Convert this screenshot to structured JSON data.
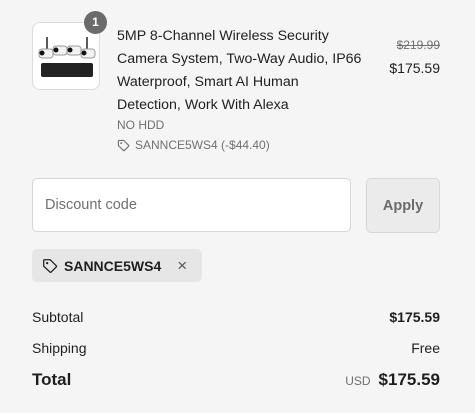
{
  "line_item": {
    "quantity": "1",
    "title": "5MP 8-Channel Wireless Security Camera System, Two-Way Audio, IP66 Waterproof, Smart AI Human Detection, Work With Alexa",
    "variant": "NO HDD",
    "discount_text": "SANNCE5WS4 (-$44.40)",
    "price_original": "$219.99",
    "price_current": "$175.59"
  },
  "discount_form": {
    "placeholder": "Discount code",
    "apply_label": "Apply"
  },
  "applied_code": {
    "code": "SANNCE5WS4",
    "remove_glyph": "×"
  },
  "summary": {
    "subtotal_label": "Subtotal",
    "subtotal_value": "$175.59",
    "shipping_label": "Shipping",
    "shipping_value": "Free",
    "total_label": "Total",
    "currency": "USD",
    "total_value": "$175.59"
  }
}
